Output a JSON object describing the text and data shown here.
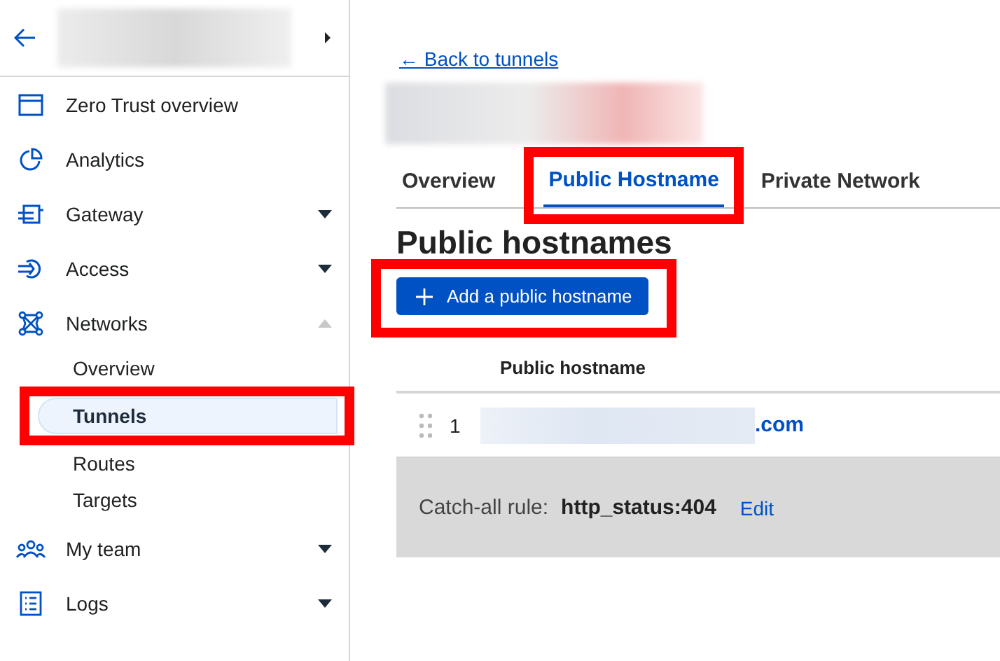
{
  "sidebar": {
    "items": [
      {
        "label": "Zero Trust overview",
        "kind": "link"
      },
      {
        "label": "Analytics",
        "kind": "link"
      },
      {
        "label": "Gateway",
        "kind": "group",
        "expanded": false
      },
      {
        "label": "Access",
        "kind": "group",
        "expanded": false
      },
      {
        "label": "Networks",
        "kind": "group",
        "expanded": true,
        "children": [
          {
            "label": "Overview",
            "selected": false,
            "highlighted": false
          },
          {
            "label": "Tunnels",
            "selected": true,
            "highlighted": true
          },
          {
            "label": "Routes",
            "selected": false,
            "highlighted": false
          },
          {
            "label": "Targets",
            "selected": false,
            "highlighted": false
          }
        ]
      },
      {
        "label": "My team",
        "kind": "group",
        "expanded": false
      },
      {
        "label": "Logs",
        "kind": "group",
        "expanded": false
      }
    ]
  },
  "back_link": "← Back to tunnels",
  "tabs": [
    {
      "label": "Overview",
      "selected": false,
      "highlighted": false
    },
    {
      "label": "Public Hostname",
      "selected": true,
      "highlighted": true
    },
    {
      "label": "Private Network",
      "selected": false,
      "highlighted": false
    }
  ],
  "heading": "Public hostnames",
  "add_button": {
    "label": "Add a public hostname",
    "highlighted": true
  },
  "table": {
    "columns": [
      "Public hostname"
    ],
    "rows": [
      {
        "number": "1",
        "hostname": ".com"
      }
    ]
  },
  "catch_all": {
    "label": "Catch-all rule:",
    "value": "http_status:404",
    "link": "Edit"
  }
}
